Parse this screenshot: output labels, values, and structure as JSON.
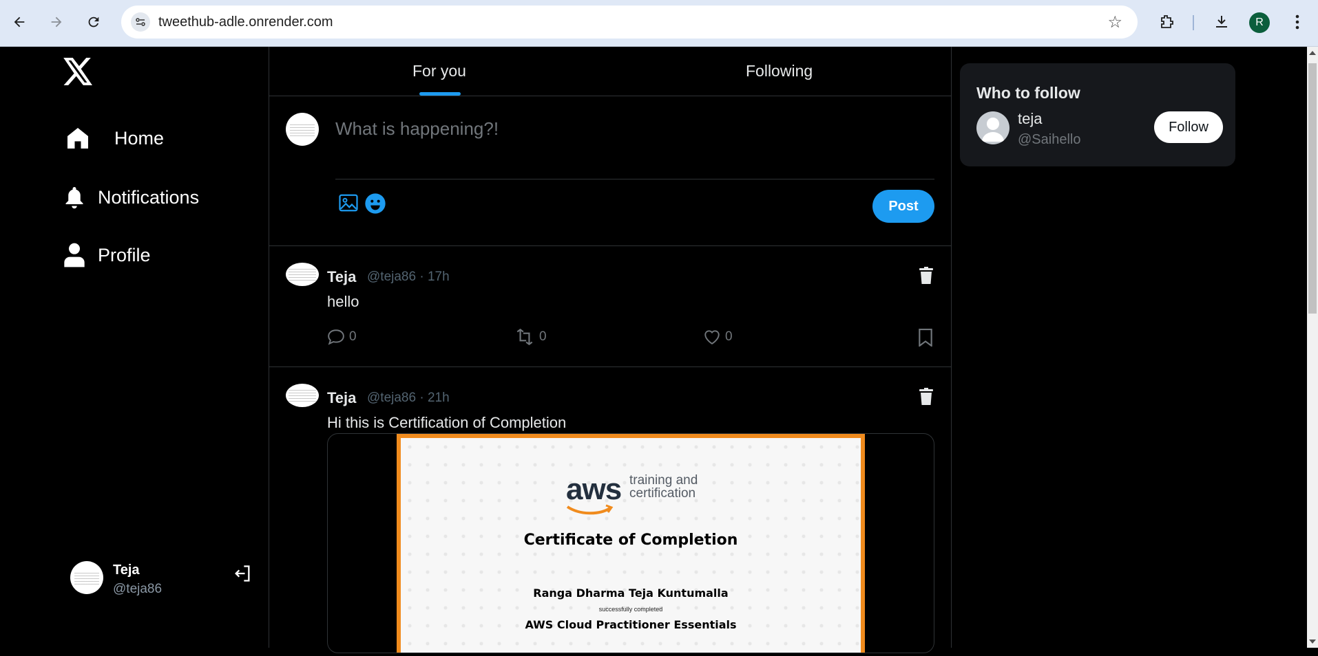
{
  "browser": {
    "url": "tweethub-adle.onrender.com",
    "profile_initial": "R"
  },
  "sidebar": {
    "items": [
      {
        "label": "Home",
        "icon": "home-icon"
      },
      {
        "label": "Notifications",
        "icon": "bell-icon"
      },
      {
        "label": "Profile",
        "icon": "user-icon"
      }
    ],
    "user": {
      "name": "Teja",
      "handle": "@teja86"
    }
  },
  "tabs": {
    "for_you": "For you",
    "following": "Following",
    "active": "For you"
  },
  "composer": {
    "placeholder": "What is happening?!",
    "post_label": "Post"
  },
  "tweets": [
    {
      "name": "Teja",
      "meta": "@teja86 · 17h",
      "text": "hello",
      "replies": "0",
      "retweets": "0",
      "likes": "0"
    },
    {
      "name": "Teja",
      "meta": "@teja86 · 21h",
      "text": "Hi this is Certification of Completion",
      "certificate": {
        "logo": "aws",
        "logo_sub_1": "training and",
        "logo_sub_2": "certification",
        "title": "Certificate of Completion",
        "recipient": "Ranga Dharma Teja Kuntumalla",
        "small": "successfully completed",
        "course": "AWS Cloud Practitioner Essentials"
      }
    }
  ],
  "who_to_follow": {
    "title": "Who to follow",
    "users": [
      {
        "name": "teja",
        "handle": "@Saihello",
        "button": "Follow"
      }
    ]
  },
  "colors": {
    "accent": "#1d9bf0",
    "background": "#000000",
    "border": "#2f3336",
    "certificate_border": "#f08b1d"
  }
}
